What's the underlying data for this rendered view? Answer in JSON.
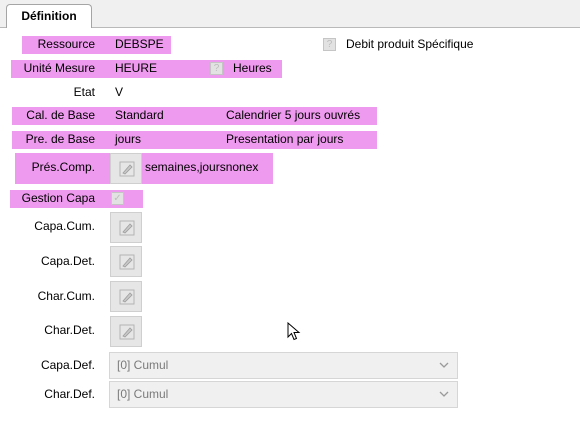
{
  "tabs": [
    {
      "label": "Définition"
    }
  ],
  "fields": {
    "ressource": {
      "label": "Ressource",
      "value": "DEBSPE"
    },
    "debit": {
      "checkbox": "?",
      "label": "Debit produit Spécifique"
    },
    "unite": {
      "label": "Unité Mesure",
      "value": "HEURE",
      "checkbox": "?",
      "unit_text": "Heures"
    },
    "etat": {
      "label": "Etat",
      "value": "V"
    },
    "cal": {
      "label": "Cal. de Base",
      "value": "Standard",
      "description": "Calendrier 5 jours ouvrés"
    },
    "pre": {
      "label": "Pre. de Base",
      "value": "jours",
      "description": "Presentation par jours"
    },
    "pres_comp": {
      "label": "Prés.Comp.",
      "value": "semaines,joursnonex"
    },
    "gestion_capa": {
      "label": "Gestion Capa",
      "checkbox": "✓"
    },
    "capa_cum": {
      "label": "Capa.Cum."
    },
    "capa_det": {
      "label": "Capa.Det."
    },
    "char_cum": {
      "label": "Char.Cum."
    },
    "char_det": {
      "label": "Char.Det."
    },
    "capa_def": {
      "label": "Capa.Def.",
      "selected": "[0] Cumul"
    },
    "char_def": {
      "label": "Char.Def.",
      "selected": "[0] Cumul"
    }
  },
  "colors": {
    "highlight": "#ee9aee",
    "tab_bg": "#f0f0f0",
    "disabled_text": "#7a7a7a"
  },
  "icons": {
    "edit_button": "edit-pencil-icon",
    "dropdown": "chevron-down-icon",
    "cursor": "mouse-pointer-icon"
  }
}
